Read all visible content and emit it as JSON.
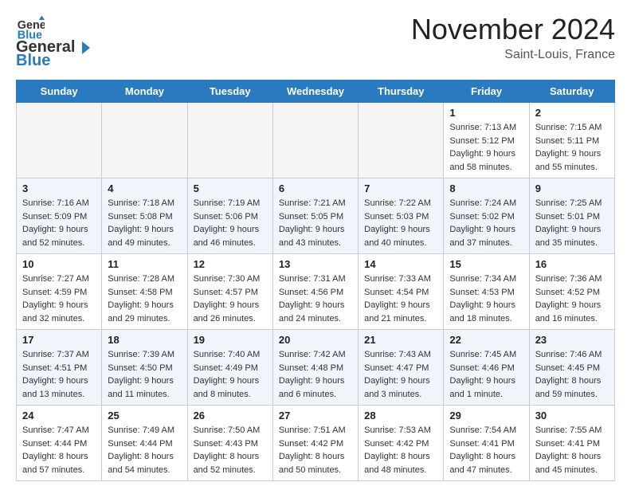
{
  "header": {
    "logo_general": "General",
    "logo_blue": "Blue",
    "month_title": "November 2024",
    "location": "Saint-Louis, France"
  },
  "weekdays": [
    "Sunday",
    "Monday",
    "Tuesday",
    "Wednesday",
    "Thursday",
    "Friday",
    "Saturday"
  ],
  "weeks": [
    [
      {
        "day": "",
        "info": ""
      },
      {
        "day": "",
        "info": ""
      },
      {
        "day": "",
        "info": ""
      },
      {
        "day": "",
        "info": ""
      },
      {
        "day": "",
        "info": ""
      },
      {
        "day": "1",
        "info": "Sunrise: 7:13 AM\nSunset: 5:12 PM\nDaylight: 9 hours\nand 58 minutes."
      },
      {
        "day": "2",
        "info": "Sunrise: 7:15 AM\nSunset: 5:11 PM\nDaylight: 9 hours\nand 55 minutes."
      }
    ],
    [
      {
        "day": "3",
        "info": "Sunrise: 7:16 AM\nSunset: 5:09 PM\nDaylight: 9 hours\nand 52 minutes."
      },
      {
        "day": "4",
        "info": "Sunrise: 7:18 AM\nSunset: 5:08 PM\nDaylight: 9 hours\nand 49 minutes."
      },
      {
        "day": "5",
        "info": "Sunrise: 7:19 AM\nSunset: 5:06 PM\nDaylight: 9 hours\nand 46 minutes."
      },
      {
        "day": "6",
        "info": "Sunrise: 7:21 AM\nSunset: 5:05 PM\nDaylight: 9 hours\nand 43 minutes."
      },
      {
        "day": "7",
        "info": "Sunrise: 7:22 AM\nSunset: 5:03 PM\nDaylight: 9 hours\nand 40 minutes."
      },
      {
        "day": "8",
        "info": "Sunrise: 7:24 AM\nSunset: 5:02 PM\nDaylight: 9 hours\nand 37 minutes."
      },
      {
        "day": "9",
        "info": "Sunrise: 7:25 AM\nSunset: 5:01 PM\nDaylight: 9 hours\nand 35 minutes."
      }
    ],
    [
      {
        "day": "10",
        "info": "Sunrise: 7:27 AM\nSunset: 4:59 PM\nDaylight: 9 hours\nand 32 minutes."
      },
      {
        "day": "11",
        "info": "Sunrise: 7:28 AM\nSunset: 4:58 PM\nDaylight: 9 hours\nand 29 minutes."
      },
      {
        "day": "12",
        "info": "Sunrise: 7:30 AM\nSunset: 4:57 PM\nDaylight: 9 hours\nand 26 minutes."
      },
      {
        "day": "13",
        "info": "Sunrise: 7:31 AM\nSunset: 4:56 PM\nDaylight: 9 hours\nand 24 minutes."
      },
      {
        "day": "14",
        "info": "Sunrise: 7:33 AM\nSunset: 4:54 PM\nDaylight: 9 hours\nand 21 minutes."
      },
      {
        "day": "15",
        "info": "Sunrise: 7:34 AM\nSunset: 4:53 PM\nDaylight: 9 hours\nand 18 minutes."
      },
      {
        "day": "16",
        "info": "Sunrise: 7:36 AM\nSunset: 4:52 PM\nDaylight: 9 hours\nand 16 minutes."
      }
    ],
    [
      {
        "day": "17",
        "info": "Sunrise: 7:37 AM\nSunset: 4:51 PM\nDaylight: 9 hours\nand 13 minutes."
      },
      {
        "day": "18",
        "info": "Sunrise: 7:39 AM\nSunset: 4:50 PM\nDaylight: 9 hours\nand 11 minutes."
      },
      {
        "day": "19",
        "info": "Sunrise: 7:40 AM\nSunset: 4:49 PM\nDaylight: 9 hours\nand 8 minutes."
      },
      {
        "day": "20",
        "info": "Sunrise: 7:42 AM\nSunset: 4:48 PM\nDaylight: 9 hours\nand 6 minutes."
      },
      {
        "day": "21",
        "info": "Sunrise: 7:43 AM\nSunset: 4:47 PM\nDaylight: 9 hours\nand 3 minutes."
      },
      {
        "day": "22",
        "info": "Sunrise: 7:45 AM\nSunset: 4:46 PM\nDaylight: 9 hours\nand 1 minute."
      },
      {
        "day": "23",
        "info": "Sunrise: 7:46 AM\nSunset: 4:45 PM\nDaylight: 8 hours\nand 59 minutes."
      }
    ],
    [
      {
        "day": "24",
        "info": "Sunrise: 7:47 AM\nSunset: 4:44 PM\nDaylight: 8 hours\nand 57 minutes."
      },
      {
        "day": "25",
        "info": "Sunrise: 7:49 AM\nSunset: 4:44 PM\nDaylight: 8 hours\nand 54 minutes."
      },
      {
        "day": "26",
        "info": "Sunrise: 7:50 AM\nSunset: 4:43 PM\nDaylight: 8 hours\nand 52 minutes."
      },
      {
        "day": "27",
        "info": "Sunrise: 7:51 AM\nSunset: 4:42 PM\nDaylight: 8 hours\nand 50 minutes."
      },
      {
        "day": "28",
        "info": "Sunrise: 7:53 AM\nSunset: 4:42 PM\nDaylight: 8 hours\nand 48 minutes."
      },
      {
        "day": "29",
        "info": "Sunrise: 7:54 AM\nSunset: 4:41 PM\nDaylight: 8 hours\nand 47 minutes."
      },
      {
        "day": "30",
        "info": "Sunrise: 7:55 AM\nSunset: 4:41 PM\nDaylight: 8 hours\nand 45 minutes."
      }
    ]
  ]
}
